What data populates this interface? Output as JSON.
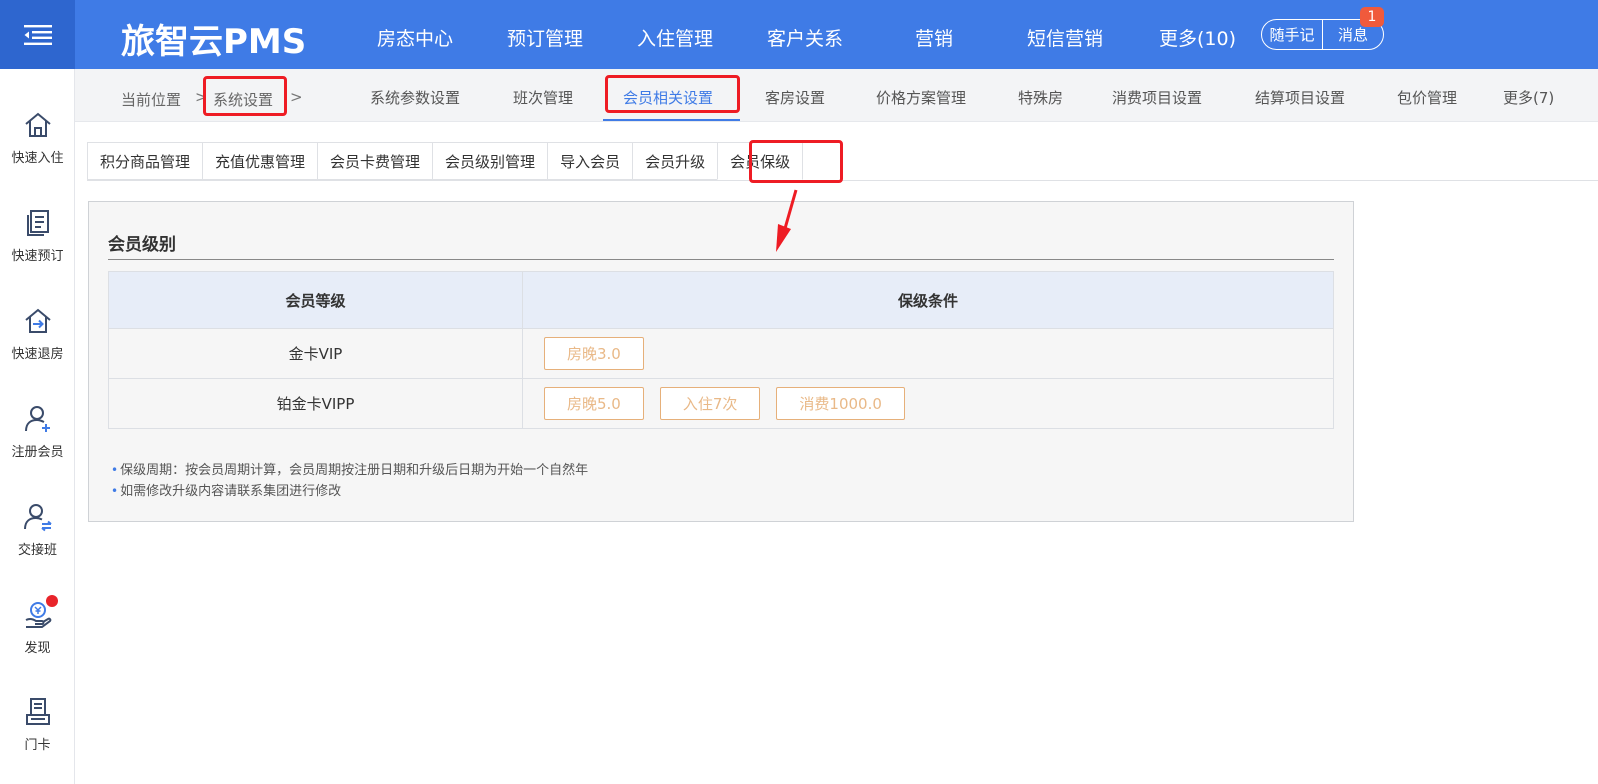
{
  "header": {
    "brand": "旅智云PMS",
    "nav": [
      "房态中心",
      "预订管理",
      "入住管理",
      "客户关系",
      "营销",
      "短信营销",
      "更多(10)"
    ],
    "notes_button": "随手记",
    "messages_button": "消息",
    "message_count": "1",
    "colors": {
      "bar": "#3f7be6",
      "toggle": "#2e66cf",
      "badge": "#f05a3c"
    }
  },
  "sidebar": {
    "items": [
      {
        "label": "快速入住",
        "icon": "house-icon"
      },
      {
        "label": "快速预订",
        "icon": "document-icon"
      },
      {
        "label": "快速退房",
        "icon": "checkout-icon"
      },
      {
        "label": "注册会员",
        "icon": "user-add-icon"
      },
      {
        "label": "交接班",
        "icon": "user-swap-icon"
      },
      {
        "label": "发现",
        "icon": "discover-icon"
      },
      {
        "label": "门卡",
        "icon": "card-printer-icon"
      }
    ]
  },
  "breadcrumb": {
    "current_label": "当前位置",
    "separator": ">",
    "section": "系统设置"
  },
  "subnav": {
    "items": [
      "系统参数设置",
      "班次管理",
      "会员相关设置",
      "客房设置",
      "价格方案管理",
      "特殊房",
      "消费项目设置",
      "结算项目设置",
      "包价管理",
      "更多(7)"
    ],
    "active": "会员相关设置"
  },
  "tabs": {
    "items": [
      "积分商品管理",
      "充值优惠管理",
      "会员卡费管理",
      "会员级别管理",
      "导入会员",
      "会员升级",
      "会员保级"
    ],
    "active": "会员保级"
  },
  "panel": {
    "title": "会员级别",
    "columns": [
      "会员等级",
      "保级条件"
    ],
    "rows": [
      {
        "level": "金卡VIP",
        "conditions": [
          "房晚3.0"
        ]
      },
      {
        "level": "铂金卡VIPP",
        "conditions": [
          "房晚5.0",
          "入住7次",
          "消费1000.0"
        ]
      }
    ],
    "notes": [
      "保级周期：按会员周期计算，会员周期按注册日期和升级后日期为开始一个自然年",
      "如需修改升级内容请联系集团进行修改"
    ]
  },
  "annotation_color": "#ee1c24"
}
